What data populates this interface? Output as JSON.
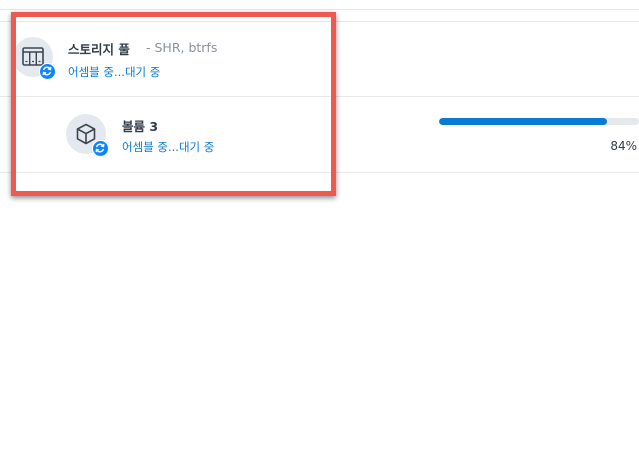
{
  "storage_pool": {
    "title": "스토리지 풀",
    "subtitle": "- SHR, btrfs",
    "status": "어셈블 중...대기 중",
    "icon": "storage-pool-icon",
    "badge_icon": "sync-icon"
  },
  "volume": {
    "title": "볼륨 3",
    "status": "어셈블 중...대기 중",
    "icon": "cube-icon",
    "badge_icon": "sync-icon",
    "progress_percent": 84,
    "progress_label": "84%"
  },
  "colors": {
    "accent": "#0a7bd4",
    "badge": "#0a84ff",
    "highlight": "#ee5a4f"
  }
}
